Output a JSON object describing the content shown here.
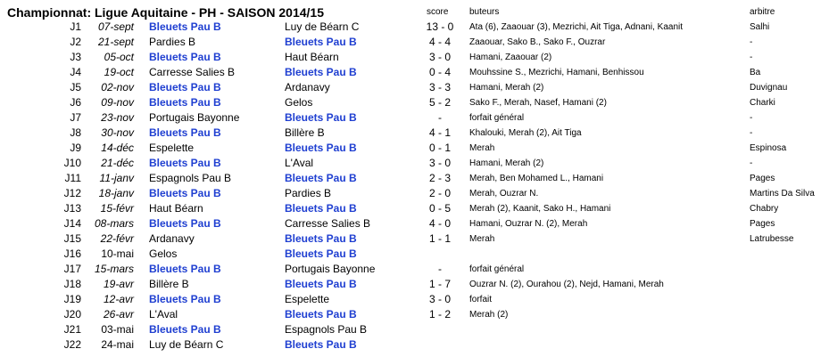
{
  "title": "Championnat: Ligue Aquitaine - PH - SAISON 2014/15",
  "headers": {
    "score": "score",
    "buteurs": "buteurs",
    "arbitre": "arbitre"
  },
  "highlight_team": "Bleuets Pau B",
  "colors": {
    "highlight": "#1f3fd1"
  },
  "matches": [
    {
      "round": "J1",
      "date": "07-sept",
      "date_italic": true,
      "home": "Bleuets Pau B",
      "away": "Luy de Béarn C",
      "score": "13 - 0",
      "buteurs": "Ata (6), Zaaouar (3), Mezrichi, Ait Tiga, Adnani, Kaanit",
      "arbitre": "Salhi"
    },
    {
      "round": "J2",
      "date": "21-sept",
      "date_italic": true,
      "home": "Pardies B",
      "away": "Bleuets Pau B",
      "score": "4 - 4",
      "buteurs": "Zaaouar, Sako B., Sako F., Ouzrar",
      "arbitre": "-"
    },
    {
      "round": "J3",
      "date": "05-oct",
      "date_italic": true,
      "home": "Bleuets Pau B",
      "away": "Haut Béarn",
      "score": "3 - 0",
      "buteurs": "Hamani, Zaaouar (2)",
      "arbitre": "-"
    },
    {
      "round": "J4",
      "date": "19-oct",
      "date_italic": true,
      "home": "Carresse Salies B",
      "away": "Bleuets Pau B",
      "score": "0 - 4",
      "buteurs": "Mouhssine S., Mezrichi, Hamani, Benhissou",
      "arbitre": "Ba"
    },
    {
      "round": "J5",
      "date": "02-nov",
      "date_italic": true,
      "home": "Bleuets Pau B",
      "away": "Ardanavy",
      "score": "3 - 3",
      "buteurs": "Hamani, Merah (2)",
      "arbitre": "Duvignau"
    },
    {
      "round": "J6",
      "date": "09-nov",
      "date_italic": true,
      "home": "Bleuets Pau B",
      "away": "Gelos",
      "score": "5 - 2",
      "buteurs": "Sako F., Merah, Nasef, Hamani (2)",
      "arbitre": "Charki"
    },
    {
      "round": "J7",
      "date": "23-nov",
      "date_italic": true,
      "home": "Portugais Bayonne",
      "away": "Bleuets Pau B",
      "score": "-",
      "buteurs": "forfait général",
      "arbitre": "-"
    },
    {
      "round": "J8",
      "date": "30-nov",
      "date_italic": true,
      "home": "Bleuets Pau B",
      "away": "Billère B",
      "score": "4 - 1",
      "buteurs": "Khalouki, Merah (2), Ait Tiga",
      "arbitre": "-"
    },
    {
      "round": "J9",
      "date": "14-déc",
      "date_italic": true,
      "home": "Espelette",
      "away": "Bleuets Pau B",
      "score": "0 - 1",
      "buteurs": "Merah",
      "arbitre": "Espinosa"
    },
    {
      "round": "J10",
      "date": "21-déc",
      "date_italic": true,
      "home": "Bleuets Pau B",
      "away": "L'Aval",
      "score": "3 - 0",
      "buteurs": "Hamani, Merah (2)",
      "arbitre": "-"
    },
    {
      "round": "J11",
      "date": "11-janv",
      "date_italic": true,
      "home": "Espagnols Pau B",
      "away": "Bleuets Pau B",
      "score": "2 - 3",
      "buteurs": "Merah, Ben Mohamed L., Hamani",
      "arbitre": "Pages"
    },
    {
      "round": "J12",
      "date": "18-janv",
      "date_italic": true,
      "home": "Bleuets Pau B",
      "away": "Pardies B",
      "score": "2 - 0",
      "buteurs": "Merah, Ouzrar N.",
      "arbitre": "Martins Da Silva"
    },
    {
      "round": "J13",
      "date": "15-févr",
      "date_italic": true,
      "home": "Haut Béarn",
      "away": "Bleuets Pau B",
      "score": "0 - 5",
      "buteurs": "Merah (2), Kaanit, Sako H., Hamani",
      "arbitre": "Chabry"
    },
    {
      "round": "J14",
      "date": "08-mars",
      "date_italic": true,
      "home": "Bleuets Pau B",
      "away": "Carresse Salies B",
      "score": "4 - 0",
      "buteurs": "Hamani, Ouzrar N. (2), Merah",
      "arbitre": "Pages"
    },
    {
      "round": "J15",
      "date": "22-févr",
      "date_italic": true,
      "home": "Ardanavy",
      "away": "Bleuets Pau B",
      "score": "1 - 1",
      "buteurs": "Merah",
      "arbitre": "Latrubesse"
    },
    {
      "round": "J16",
      "date": "10-mai",
      "date_italic": false,
      "home": "Gelos",
      "away": "Bleuets Pau B",
      "score": "",
      "buteurs": "",
      "arbitre": ""
    },
    {
      "round": "J17",
      "date": "15-mars",
      "date_italic": true,
      "home": "Bleuets Pau B",
      "away": "Portugais Bayonne",
      "score": "-",
      "buteurs": "forfait général",
      "arbitre": ""
    },
    {
      "round": "J18",
      "date": "19-avr",
      "date_italic": true,
      "home": "Billère B",
      "away": "Bleuets Pau B",
      "score": "1 - 7",
      "buteurs": "Ouzrar N. (2), Ourahou (2), Nejd, Hamani, Merah",
      "arbitre": ""
    },
    {
      "round": "J19",
      "date": "12-avr",
      "date_italic": true,
      "home": "Bleuets Pau B",
      "away": "Espelette",
      "score": "3 - 0",
      "buteurs": "forfait",
      "arbitre": ""
    },
    {
      "round": "J20",
      "date": "26-avr",
      "date_italic": true,
      "home": "L'Aval",
      "away": "Bleuets Pau B",
      "score": "1 - 2",
      "buteurs": "Merah (2)",
      "arbitre": ""
    },
    {
      "round": "J21",
      "date": "03-mai",
      "date_italic": false,
      "home": "Bleuets Pau B",
      "away": "Espagnols Pau B",
      "score": "",
      "buteurs": "",
      "arbitre": ""
    },
    {
      "round": "J22",
      "date": "24-mai",
      "date_italic": false,
      "home": "Luy de Béarn C",
      "away": "Bleuets Pau B",
      "score": "",
      "buteurs": "",
      "arbitre": ""
    }
  ]
}
